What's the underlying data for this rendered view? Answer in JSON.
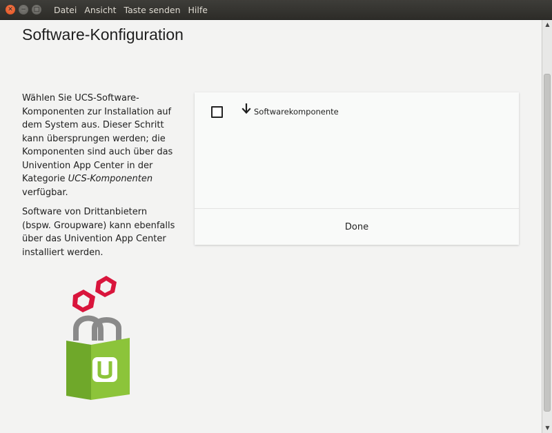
{
  "window": {
    "menu": [
      "Datei",
      "Ansicht",
      "Taste senden",
      "Hilfe"
    ]
  },
  "page": {
    "title": "Software-Konfiguration",
    "description": {
      "p1_text": "Wählen Sie UCS-Software-Komponenten zur Installation auf dem System aus. Dieser Schritt kann übersprungen werden; die Komponenten sind auch über das Univention App Center in der Kategorie ",
      "p1_emphasis": "UCS-Komponenten",
      "p1_tail": " verfügbar.",
      "p2": "Software von Drittanbietern (bspw. Groupware) kann ebenfalls über das Univention App Center installiert werden."
    }
  },
  "components": {
    "item": {
      "label": "Softwarekomponente",
      "checked": false,
      "icon": "arrow-down-icon"
    },
    "done_label": "Done"
  },
  "icons": {
    "close": "close-icon",
    "minimize": "minimize-icon",
    "maximize": "maximize-icon",
    "logo": "univention-app-center-logo"
  },
  "colors": {
    "logo_green": "#8cc43a",
    "logo_red": "#d9153c",
    "logo_gray": "#8a8a8a",
    "accent_titlebar": "#3c3b37"
  }
}
